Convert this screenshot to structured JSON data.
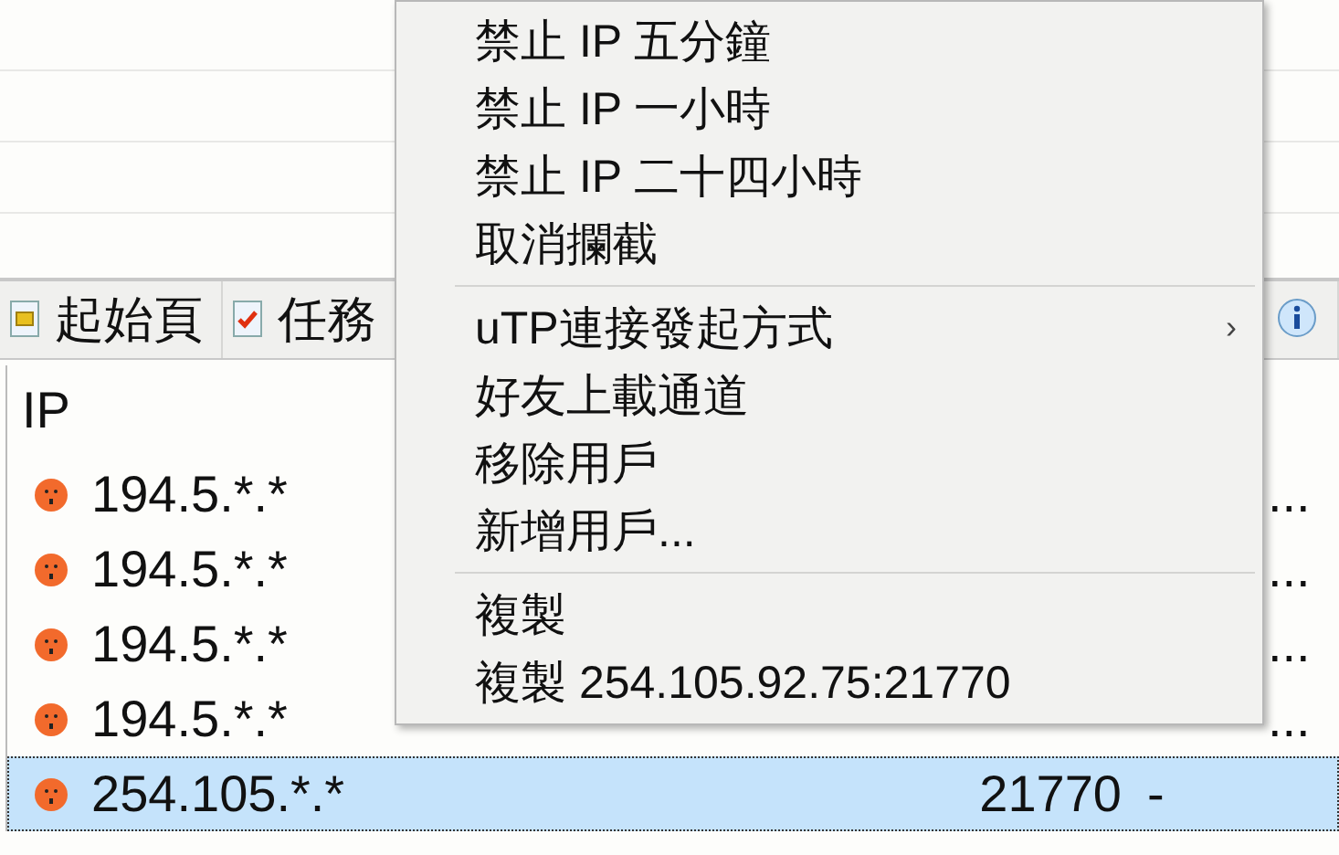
{
  "tabs": [
    {
      "label": "起始頁",
      "kind": "page",
      "selected": false
    },
    {
      "label": "任務",
      "kind": "checklist",
      "selected": false
    },
    {
      "kind": "info",
      "selected": false
    }
  ],
  "peers": {
    "columns": [
      "IP"
    ],
    "rows": [
      {
        "ip": "194.5.*.*",
        "column_5": "...",
        "selected": false
      },
      {
        "ip": "194.5.*.*",
        "column_5": "...",
        "selected": false
      },
      {
        "ip": "194.5.*.*",
        "column_5": "...",
        "selected": false
      },
      {
        "ip": "194.5.*.*",
        "column_5": "...",
        "selected": false
      },
      {
        "ip": "254.105.*.*",
        "port": "21770",
        "column_4": "-",
        "selected": true
      }
    ]
  },
  "context_menu": {
    "groups": [
      [
        {
          "label": "禁止 IP 五分鐘"
        },
        {
          "label": "禁止 IP 一小時"
        },
        {
          "label": "禁止 IP 二十四小時"
        },
        {
          "label": "取消攔截"
        }
      ],
      [
        {
          "label": "uTP連接發起方式",
          "arrow": "›"
        },
        {
          "label": "好友上載通道"
        },
        {
          "label": "移除用戶"
        },
        {
          "label": "新增用戶..."
        }
      ],
      [
        {
          "label": "複製"
        },
        {
          "label": "複製 254.105.92.75:21770"
        }
      ]
    ]
  }
}
